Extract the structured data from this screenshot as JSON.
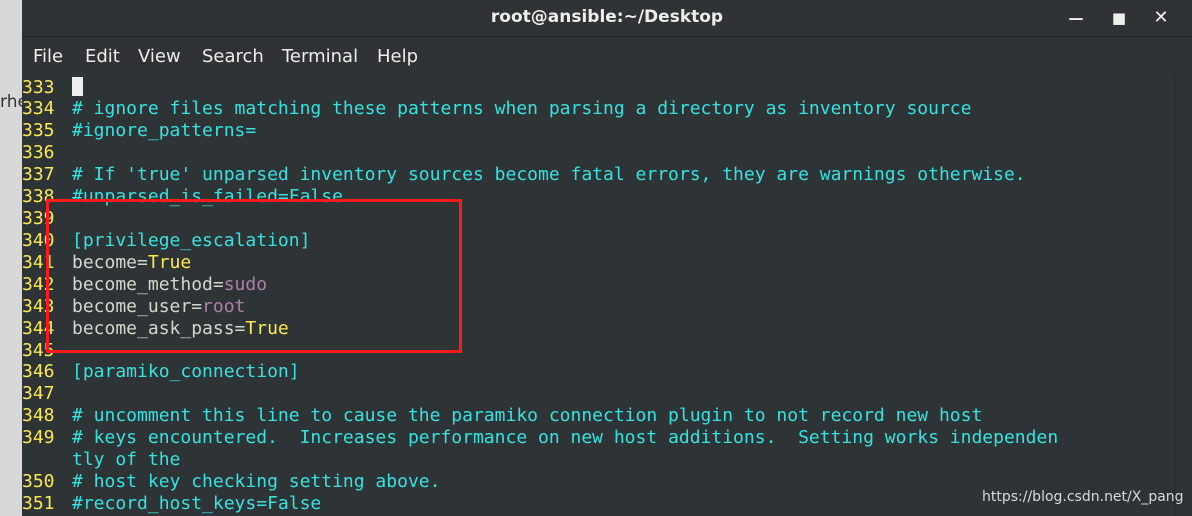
{
  "window": {
    "title": "root@ansible:~/Desktop",
    "min_icon": "minimize-icon",
    "max_icon": "maximize-icon",
    "close_icon": "close-icon"
  },
  "desktop_fragment": "rhe",
  "menu": [
    "File",
    "Edit",
    "View",
    "Search",
    "Terminal",
    "Help"
  ],
  "lines": [
    {
      "num": "333",
      "text": ""
    },
    {
      "num": "334",
      "text": "# ignore files matching these patterns when parsing a directory as inventory source"
    },
    {
      "num": "335",
      "text": "#ignore_patterns="
    },
    {
      "num": "336",
      "text": ""
    },
    {
      "num": "337",
      "text": "# If 'true' unparsed inventory sources become fatal errors, they are warnings otherwise."
    },
    {
      "num": "338",
      "text": "#unparsed_is_failed=False"
    },
    {
      "num": "339",
      "text": ""
    },
    {
      "num": "340",
      "text": "[privilege_escalation]"
    },
    {
      "num": "341",
      "key": "become=",
      "value": "True"
    },
    {
      "num": "342",
      "key": "become_method=",
      "value": "sudo"
    },
    {
      "num": "343",
      "key": "become_user=",
      "value": "root"
    },
    {
      "num": "344",
      "key": "become_ask_pass=",
      "value": "True"
    },
    {
      "num": "345",
      "text": ""
    },
    {
      "num": "346",
      "text": "[paramiko_connection]"
    },
    {
      "num": "347",
      "text": ""
    },
    {
      "num": "348",
      "text": "# uncomment this line to cause the paramiko connection plugin to not record new host"
    },
    {
      "num": "349",
      "text": "# keys encountered.  Increases performance on new host additions.  Setting works independen"
    },
    {
      "num": "",
      "text": "tly of the"
    },
    {
      "num": "350",
      "text": "# host key checking setting above."
    },
    {
      "num": "351",
      "text": "#record_host_keys=False"
    }
  ],
  "watermark": "https://blog.csdn.net/X_pang",
  "colors": {
    "background": "#2e3436",
    "line_number": "#fce94f",
    "comment": "#34e2e2",
    "boolean": "#fce94f",
    "string": "#ad7fa8",
    "highlight_box": "#ff1a1a"
  }
}
